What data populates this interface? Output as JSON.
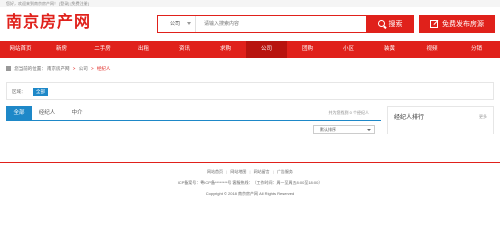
{
  "topbar": {
    "greeting": "您好，欢迎来到南京房产网！",
    "login": "[登录]",
    "register": "[免费注册]"
  },
  "header": {
    "logo_text": "南京房产网",
    "search": {
      "category": "公司",
      "placeholder": "请输入搜索内容",
      "button": "搜索"
    },
    "publish_button": "免费发布房源"
  },
  "nav": {
    "items": [
      "网站首页",
      "新房",
      "二手房",
      "出租",
      "资讯",
      "求购",
      "公司",
      "团购",
      "小区",
      "装黄",
      "视频",
      "分销"
    ],
    "active_index": 6
  },
  "breadcrumb": {
    "prefix": "您当前的位置：",
    "items": [
      "南京房产网",
      "公司"
    ],
    "current": "经纪人"
  },
  "filter": {
    "label": "区域：",
    "selected": "全部"
  },
  "tabs": {
    "items": [
      "全部",
      "经纪人",
      "中介"
    ],
    "active_index": 0,
    "count_text": "共为您找到 0 个经纪人"
  },
  "sort": {
    "value": "默认排序"
  },
  "ranking": {
    "title": "经纪人排行",
    "more": "更多"
  },
  "footer": {
    "links": [
      "网站首页",
      "网站地图",
      "网站留言",
      "广告服务"
    ],
    "icp": "ICP备案号：粤ICP备********号  客服热线：（工作时间：周一至周五8:00至18:00）",
    "copyright": "Copyright © 2018 南京房产网 All Rights Reserved"
  },
  "colors": {
    "brand_red": "#e0211b",
    "active_blue": "#1e88c8"
  }
}
